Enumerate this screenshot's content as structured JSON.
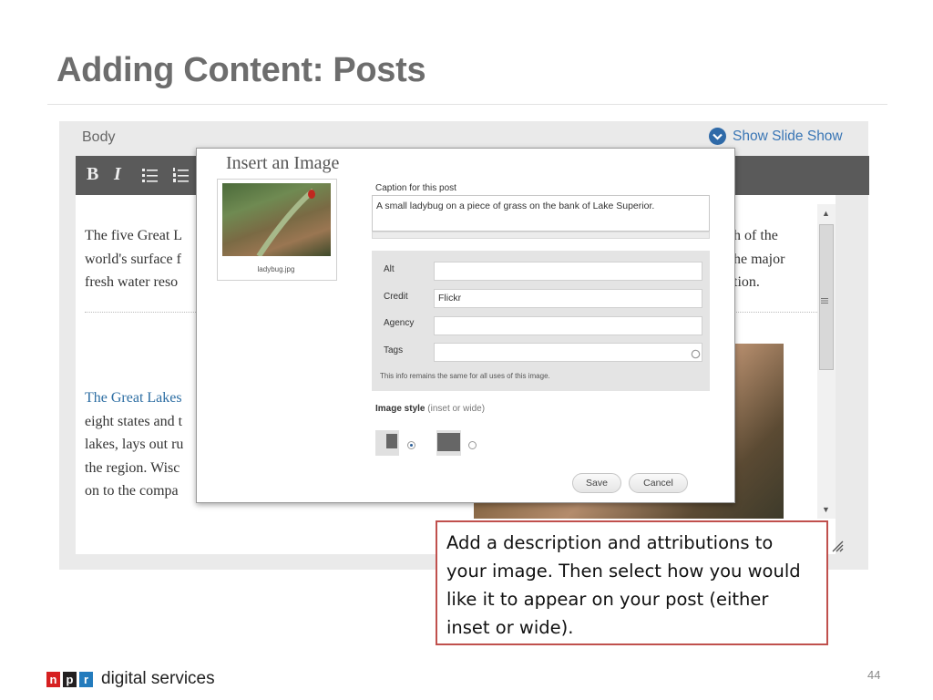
{
  "slide": {
    "title": "Adding Content: Posts",
    "page_number": "44"
  },
  "editor": {
    "body_label": "Body",
    "slideshow_link": "Show Slide Show",
    "toolbar": {
      "bold": "B",
      "italic": "I"
    },
    "para1": [
      "The five Great L",
      "world's surface f",
      "fresh water reso"
    ],
    "para1_right": [
      "h of the",
      "he major",
      "tion."
    ],
    "para2_link": "The Great Lakes",
    "para2": [
      "eight states and t",
      "lakes, lays out ru",
      "the region. Wisc",
      "on to the compa"
    ]
  },
  "dialog": {
    "title": "Insert an Image",
    "thumbnail_name": "ladybug.jpg",
    "caption_label": "Caption for this post",
    "caption_value": "A small ladybug on a piece of grass on the bank of Lake Superior.",
    "fields": [
      {
        "label": "Alt",
        "value": ""
      },
      {
        "label": "Credit",
        "value": "Flickr"
      },
      {
        "label": "Agency",
        "value": ""
      },
      {
        "label": "Tags",
        "value": ""
      }
    ],
    "info_note": "This info remains the same for all uses of this image.",
    "image_style_label": "Image style",
    "image_style_hint": "(inset or wide)",
    "image_style_selected": "inset",
    "save_label": "Save",
    "cancel_label": "Cancel"
  },
  "callout": {
    "text": "Add a description and attributions to your image. Then select how you would like it to appear on your post (either inset or wide)."
  },
  "footer": {
    "logo_letters": [
      "n",
      "p",
      "r"
    ],
    "logo_colors": [
      "#d62021",
      "#231f20",
      "#237bbd"
    ],
    "brand_text": "digital services"
  }
}
